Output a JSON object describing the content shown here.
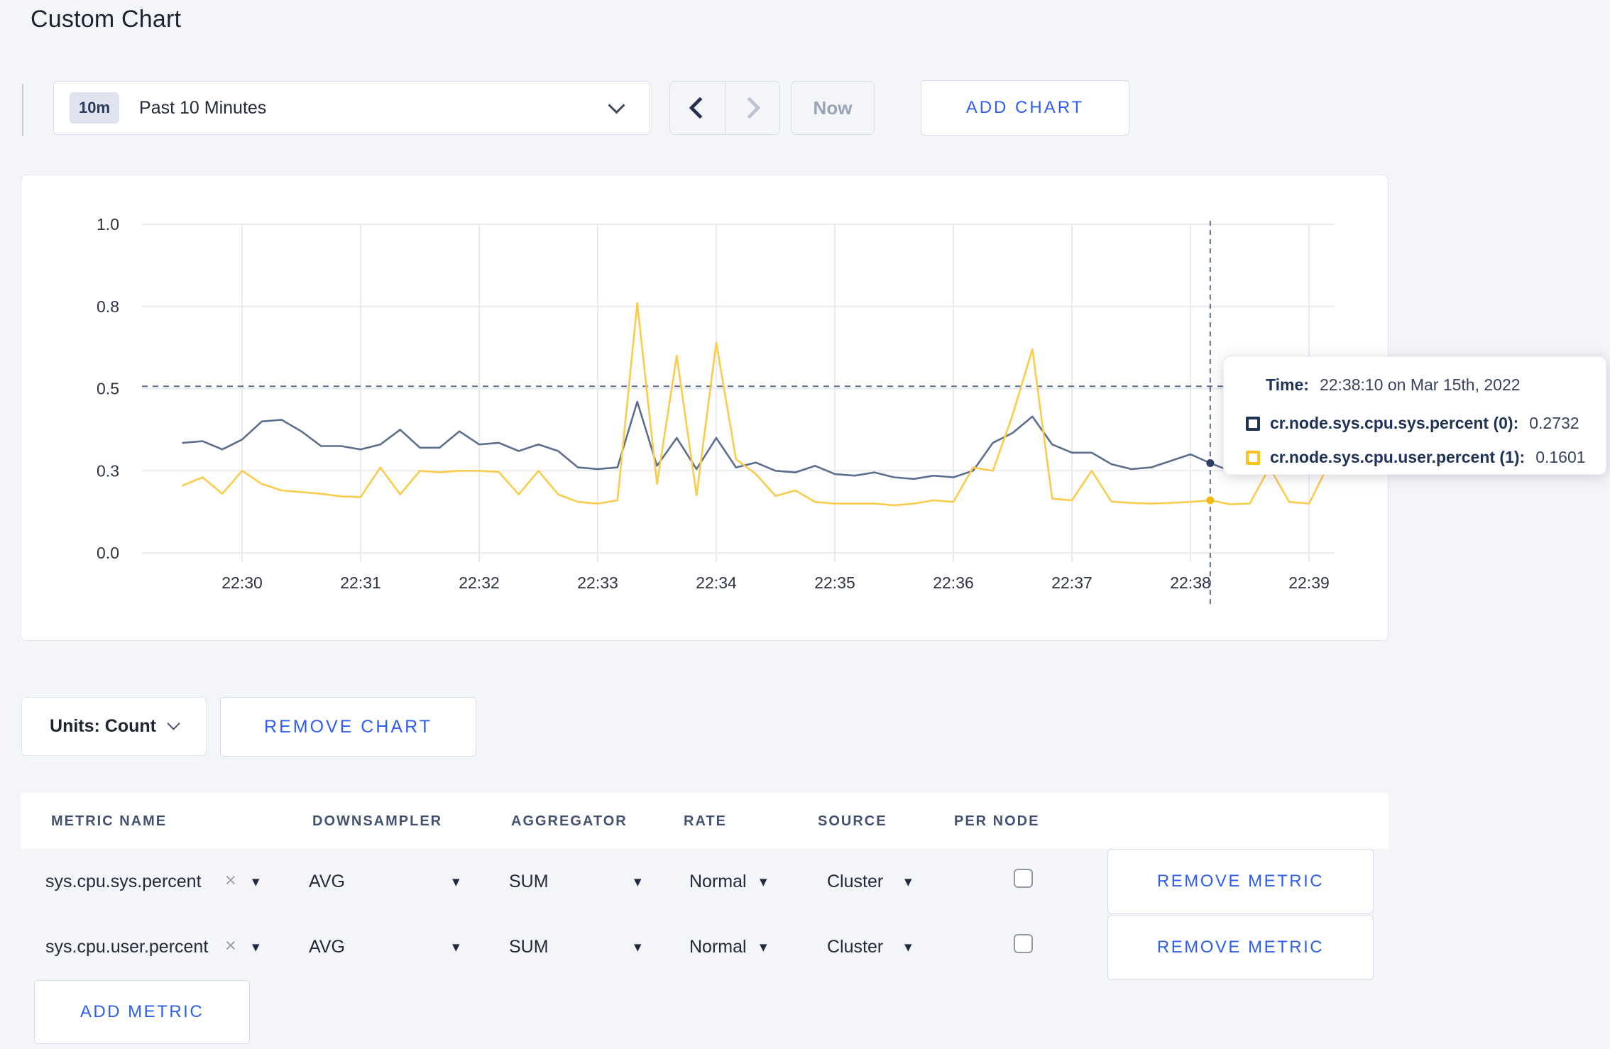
{
  "page": {
    "title": "Custom Chart"
  },
  "toolbar": {
    "time_range": {
      "badge": "10m",
      "label": "Past 10 Minutes"
    },
    "now_label": "Now",
    "add_chart_label": "ADD CHART"
  },
  "chart": {
    "crosshair": {
      "time": "22:38:10",
      "x_minutes_after_2230": 8.1667,
      "hover_value": 0.507,
      "markers": [
        {
          "value": 0.2732,
          "color": "#2c3e63"
        },
        {
          "value": 0.1601,
          "color": "#f3b90c"
        }
      ]
    },
    "tooltip": {
      "time_label": "Time:",
      "time_value": "22:38:10 on Mar 15th, 2022",
      "rows": [
        {
          "name": "cr.node.sys.cpu.sys.percent (0):",
          "value": "0.2732",
          "color": "#1f3254"
        },
        {
          "name": "cr.node.sys.cpu.user.percent (1):",
          "value": "0.1601",
          "color": "#fdc21c"
        }
      ]
    }
  },
  "chart_data": {
    "type": "line",
    "title": "",
    "xlabel": "",
    "ylabel": "",
    "ylim": [
      0,
      1
    ],
    "grid": true,
    "y_tick_values": [
      0,
      0.25,
      0.5,
      0.75,
      1.0
    ],
    "y_tick_labels": [
      "0.0",
      "0.3",
      "0.5",
      "0.8",
      "1.0"
    ],
    "x_tick_labels": [
      "22:30",
      "22:31",
      "22:32",
      "22:33",
      "22:34",
      "22:35",
      "22:36",
      "22:37",
      "22:38",
      "22:39"
    ],
    "x_start_time": "22:29:30",
    "x_interval_seconds": 10,
    "x_offset_minutes": -0.5,
    "series": [
      {
        "name": "cr.node.sys.cpu.sys.percent (0)",
        "color": "#5d6e8c",
        "values": [
          0.335,
          0.34,
          0.315,
          0.345,
          0.4,
          0.405,
          0.37,
          0.325,
          0.325,
          0.315,
          0.33,
          0.375,
          0.32,
          0.32,
          0.37,
          0.33,
          0.335,
          0.31,
          0.33,
          0.31,
          0.26,
          0.255,
          0.26,
          0.46,
          0.265,
          0.35,
          0.255,
          0.35,
          0.26,
          0.275,
          0.25,
          0.245,
          0.265,
          0.24,
          0.235,
          0.245,
          0.23,
          0.225,
          0.235,
          0.23,
          0.25,
          0.335,
          0.365,
          0.415,
          0.33,
          0.305,
          0.305,
          0.27,
          0.255,
          0.26,
          0.28,
          0.3,
          0.2732,
          0.25,
          0.255,
          0.285,
          0.28,
          0.27,
          0.3
        ]
      },
      {
        "name": "cr.node.sys.cpu.user.percent (1)",
        "color": "#fbcb4c",
        "values": [
          0.205,
          0.23,
          0.18,
          0.25,
          0.21,
          0.19,
          0.185,
          0.18,
          0.172,
          0.17,
          0.26,
          0.178,
          0.25,
          0.245,
          0.25,
          0.25,
          0.246,
          0.178,
          0.25,
          0.178,
          0.155,
          0.15,
          0.16,
          0.76,
          0.21,
          0.6,
          0.175,
          0.64,
          0.285,
          0.24,
          0.173,
          0.19,
          0.155,
          0.15,
          0.15,
          0.15,
          0.145,
          0.15,
          0.16,
          0.155,
          0.26,
          0.25,
          0.42,
          0.62,
          0.165,
          0.16,
          0.25,
          0.156,
          0.152,
          0.15,
          0.152,
          0.155,
          0.1601,
          0.148,
          0.15,
          0.26,
          0.155,
          0.15,
          0.27
        ]
      }
    ]
  },
  "chart_controls": {
    "units_label": "Units: Count",
    "remove_chart_label": "REMOVE CHART"
  },
  "metrics_table": {
    "headers": [
      "METRIC NAME",
      "DOWNSAMPLER",
      "AGGREGATOR",
      "RATE",
      "SOURCE",
      "PER NODE"
    ],
    "rows": [
      {
        "metric": "sys.cpu.sys.percent",
        "downsampler": "AVG",
        "aggregator": "SUM",
        "rate": "Normal",
        "source": "Cluster",
        "per_node_checked": false,
        "remove_label": "REMOVE METRIC"
      },
      {
        "metric": "sys.cpu.user.percent",
        "downsampler": "AVG",
        "aggregator": "SUM",
        "rate": "Normal",
        "source": "Cluster",
        "per_node_checked": false,
        "remove_label": "REMOVE METRIC"
      }
    ],
    "add_metric_label": "ADD METRIC"
  }
}
